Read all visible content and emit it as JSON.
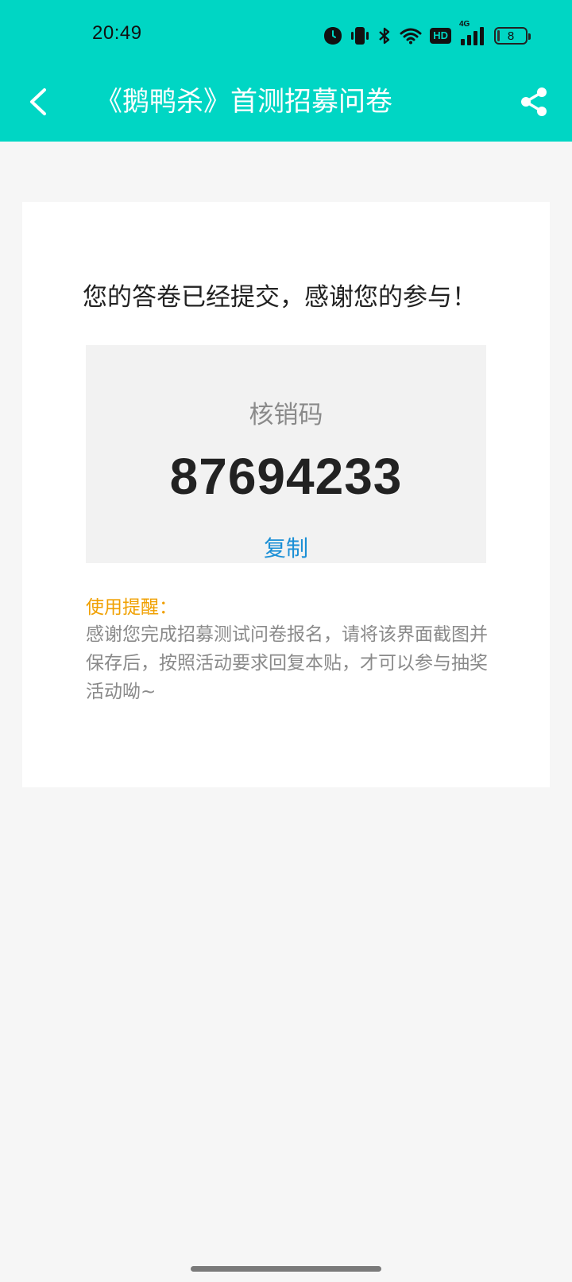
{
  "status_bar": {
    "time": "20:49",
    "network_badge": "HD",
    "network_type": "4G",
    "battery_level": "8"
  },
  "header": {
    "title": "《鹅鸭杀》首测招募问卷",
    "back_icon": "chevron-left-icon",
    "share_icon": "share-icon",
    "background_color": "#00d6c4"
  },
  "card": {
    "message": "您的答卷已经提交，感谢您的参与！",
    "code_label": "核销码",
    "code_value": "87694233",
    "copy_label": "复制",
    "reminder_title": "使用提醒：",
    "reminder_text": "感谢您完成招募测试问卷报名，请将该界面截图并保存后，按照活动要求回复本贴，才可以参与抽奖活动呦~"
  },
  "colors": {
    "accent": "#00d6c4",
    "link": "#1a8fd6",
    "reminder": "#f0a000"
  }
}
